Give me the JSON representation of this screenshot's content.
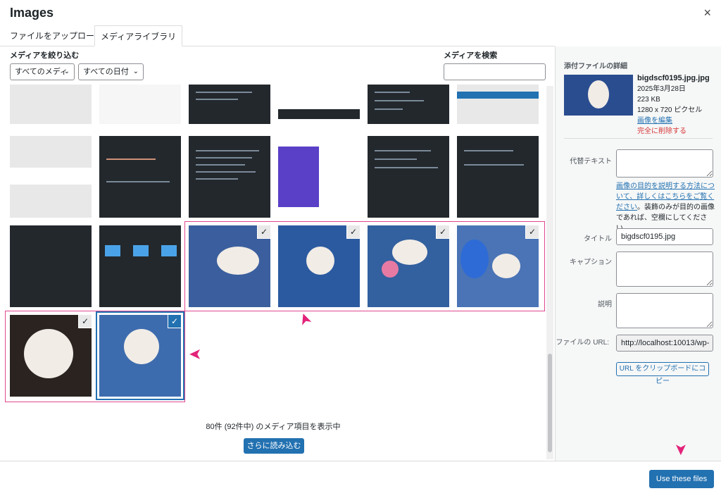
{
  "modal": {
    "title": "Images",
    "close": "×"
  },
  "tabs": [
    "ファイルをアップロード",
    "メディアライブラリ"
  ],
  "filters": {
    "label": "メディアを絞り込む",
    "type": "すべてのメディ",
    "date": "すべての日付"
  },
  "search": {
    "label": "メディアを検索",
    "value": ""
  },
  "grid": {
    "count_text": "80件 (92件中) のメディア項目を表示中",
    "load_more": "さらに読み込む"
  },
  "sidebar": {
    "heading": "添付ファイルの詳細",
    "filename": "bigdscf0195.jpg.jpg",
    "date": "2025年3月28日",
    "size": "223 KB",
    "dimensions": "1280 x 720 ピクセル",
    "edit_link": "画像を編集",
    "delete_link": "完全に削除する",
    "alt_label": "代替テキスト",
    "alt_help_link": "画像の目的を説明する方法について、詳しくはこちらをご覧ください",
    "alt_help_text": "。装飾のみが目的の画像であれば、空欄にしてください。",
    "title_label": "タイトル",
    "title_value": "bigdscf0195.jpg",
    "caption_label": "キャプション",
    "description_label": "説明",
    "url_label": "ファイルの URL:",
    "url_value": "http://localhost:10013/wp-",
    "copy_button": "URL をクリップボードにコピー"
  },
  "footer": {
    "use_button": "Use these files"
  },
  "icons": {
    "check": "✓",
    "arrow": "➤"
  }
}
